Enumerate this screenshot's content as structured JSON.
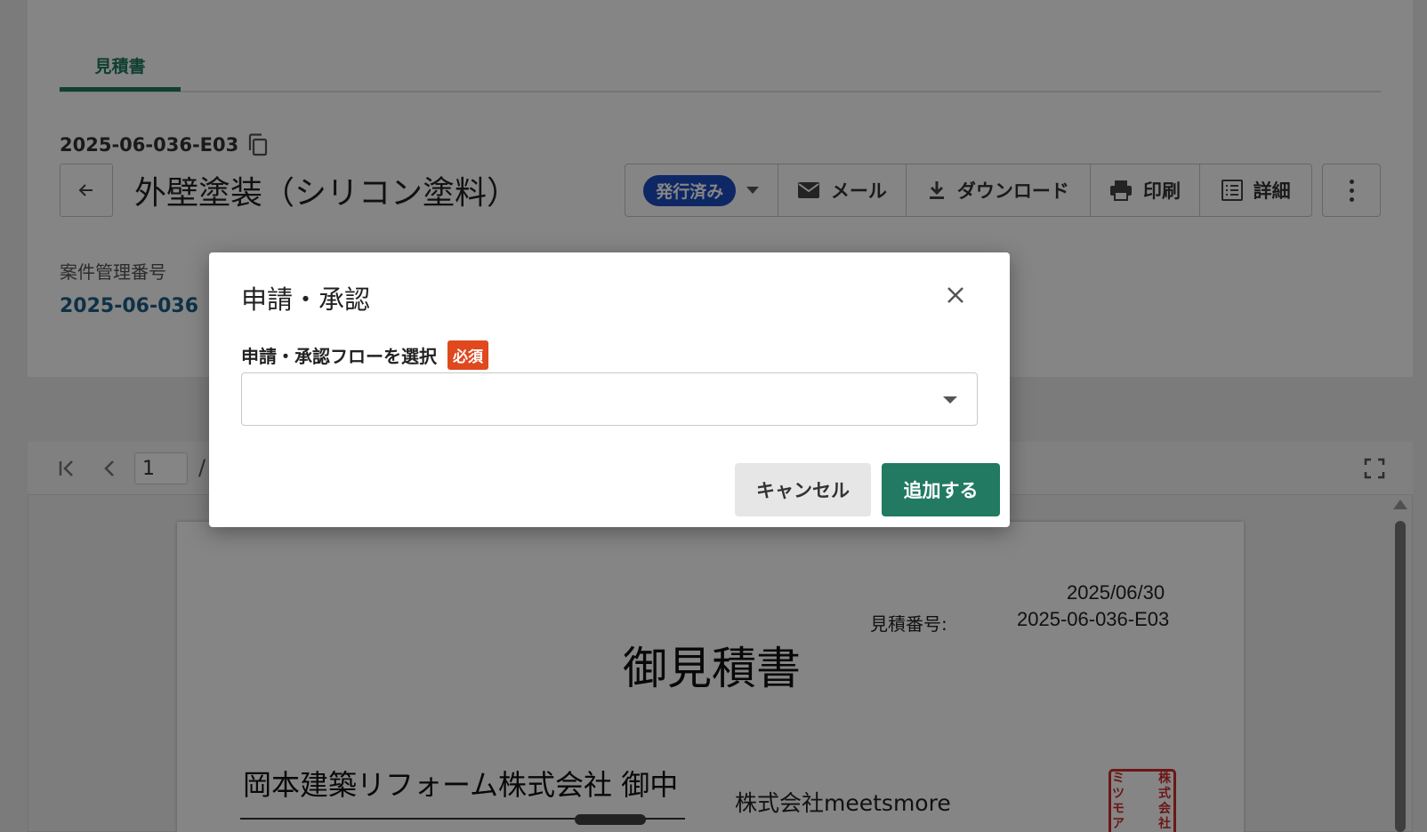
{
  "tabs": [
    {
      "label": "見積書",
      "active": true
    }
  ],
  "header": {
    "doc_id": "2025-06-036-E03",
    "title": "外壁塗装（シリコン塗料）",
    "status": "発行済み",
    "actions": {
      "mail": "メール",
      "download": "ダウンロード",
      "print": "印刷",
      "detail": "詳細"
    }
  },
  "case": {
    "label": "案件管理番号",
    "value": "2025-06-036"
  },
  "viewer": {
    "page": "1",
    "separator": "/"
  },
  "document": {
    "date": "2025/06/30",
    "number_label": "見積番号:",
    "number_value": "2025-06-036-E03",
    "heading": "御見積書",
    "recipient": "岡本建築リフォーム株式会社 御中",
    "sender": "株式会社meetsmore",
    "seal_right": "株式会社",
    "seal_left": "ミツモア"
  },
  "modal": {
    "title": "申請・承認",
    "field_label": "申請・承認フローを選択",
    "required": "必須",
    "select_value": "",
    "cancel": "キャンセル",
    "submit": "追加する"
  },
  "colors": {
    "accent": "#217a61",
    "status": "#1b4cc2",
    "required": "#e0481e",
    "link": "#1b5f86"
  }
}
